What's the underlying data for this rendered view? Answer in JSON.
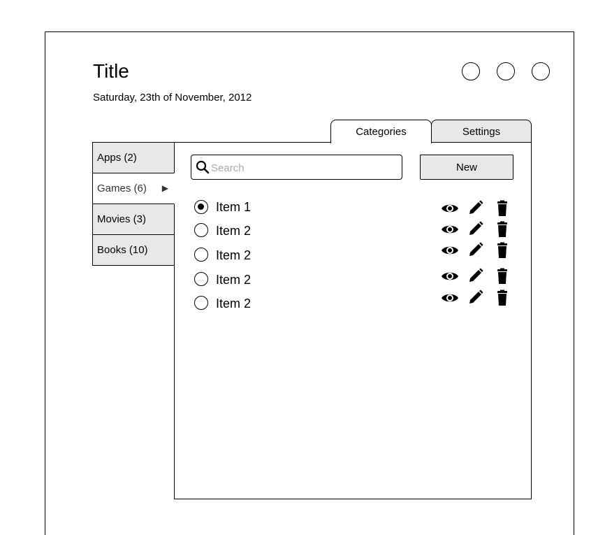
{
  "header": {
    "title": "Title",
    "date": "Saturday, 23th of November, 2012"
  },
  "window_controls": [
    "circle-button",
    "circle-button",
    "circle-button"
  ],
  "tabs": [
    {
      "label": "Categories",
      "active": true
    },
    {
      "label": "Settings",
      "active": false
    }
  ],
  "sidebar": {
    "items": [
      {
        "label": "Apps (2)",
        "active": false
      },
      {
        "label": "Games (6)",
        "active": true,
        "arrow": "▶"
      },
      {
        "label": "Movies (3)",
        "active": false
      },
      {
        "label": "Books (10)",
        "active": false
      }
    ]
  },
  "search": {
    "placeholder": "Search",
    "value": "",
    "icon": "search-icon"
  },
  "new_button": {
    "label": "New"
  },
  "list": {
    "items": [
      {
        "label": "Item 1",
        "selected": true
      },
      {
        "label": "Item 2",
        "selected": false
      },
      {
        "label": "Item 2",
        "selected": false
      },
      {
        "label": "Item 2",
        "selected": false
      },
      {
        "label": "Item 2",
        "selected": false
      }
    ],
    "actions": [
      "view-icon",
      "edit-icon",
      "delete-icon"
    ]
  },
  "colors": {
    "inactive_bg": "#e8e8e8",
    "border": "#000000",
    "placeholder": "#aaaaaa"
  }
}
